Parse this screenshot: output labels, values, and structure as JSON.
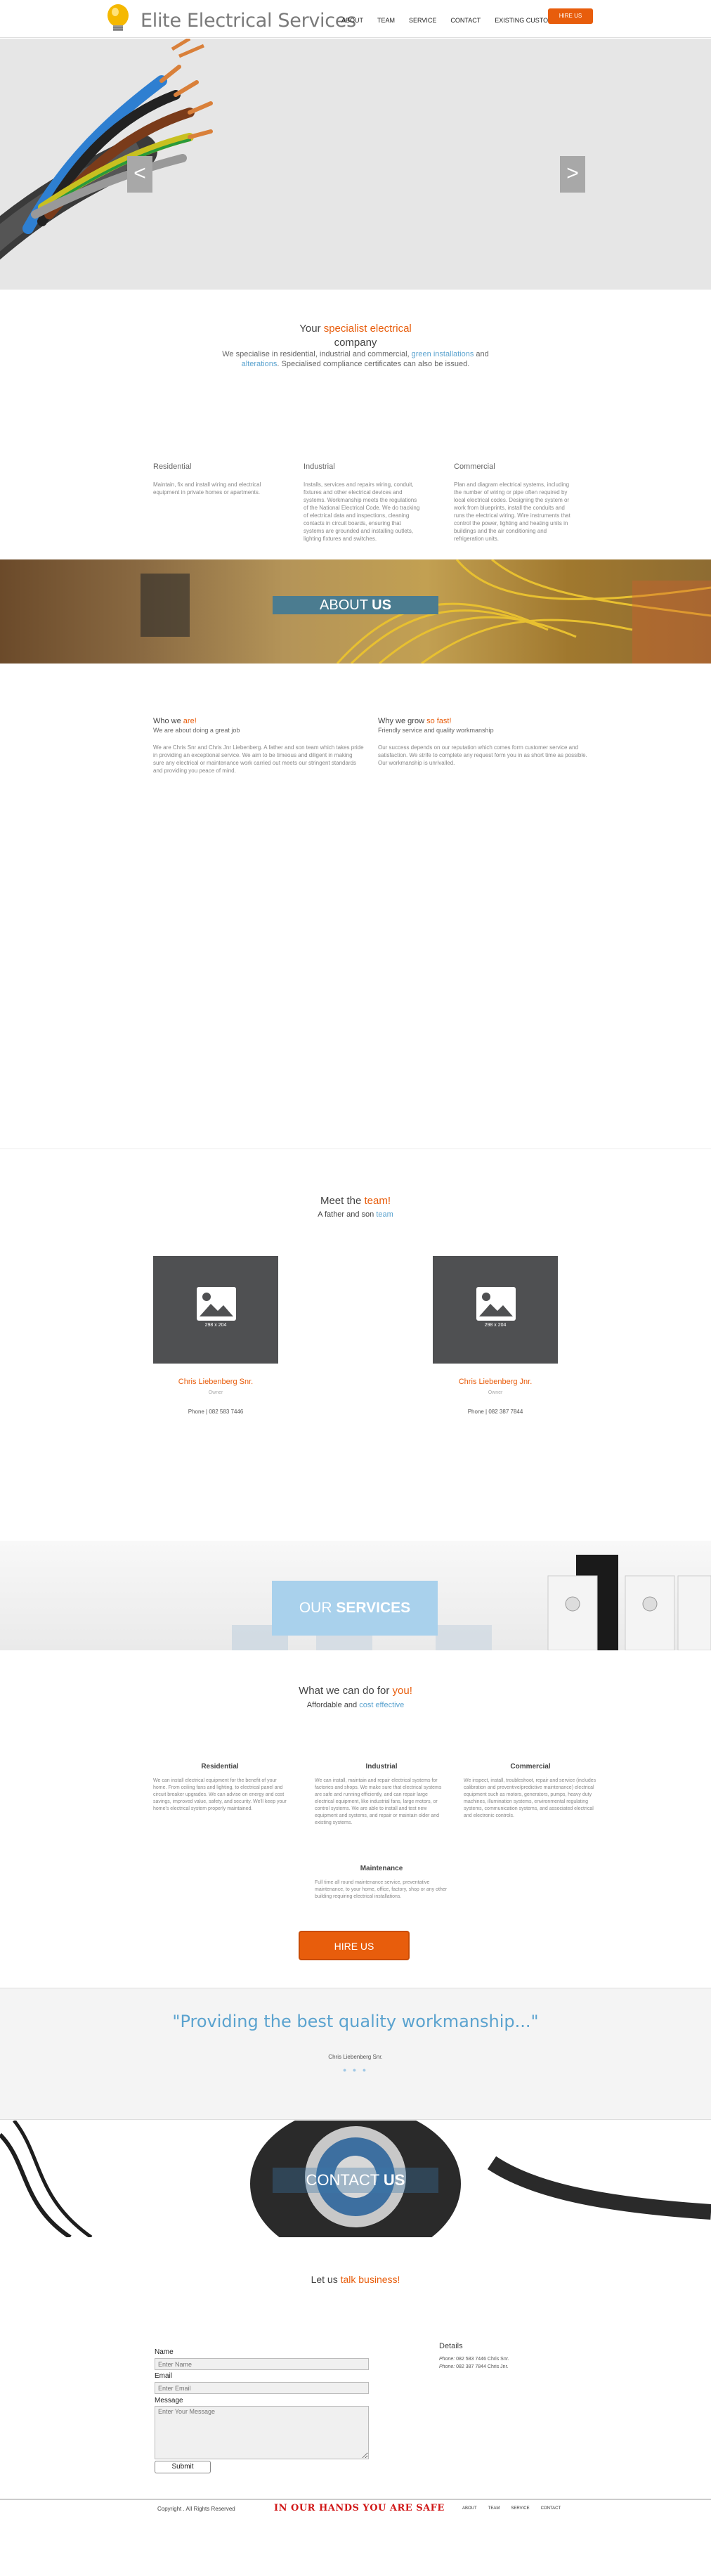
{
  "header": {
    "logo_text": "Elite Electrical Services",
    "nav": [
      "ABOUT",
      "TEAM",
      "SERVICE",
      "CONTACT",
      "EXISTING CUSTOMER"
    ],
    "hire_button": "HIRE US"
  },
  "hero": {
    "prev": "<",
    "next": ">"
  },
  "specialist": {
    "title_pre": "Your ",
    "title_highlight": "specialist electrical",
    "title_post": "company",
    "desc_1": "We specialise in residential, industrial and commercial, ",
    "desc_link_1": "green installations",
    "desc_2": " and ",
    "desc_link_2": "alterations",
    "desc_3": ". Specialised compliance certificates can also be issued."
  },
  "sectors": [
    {
      "title": "Residential",
      "text": "Maintain, fix and install wiring and electrical equipment in private homes or apartments."
    },
    {
      "title": "Industrial",
      "text": "Installs, services and repairs wiring, conduit, fixtures and other electrical devices and systems. Workmanship meets the regulations of the National Electrical Code. We do tracking of electrical data and inspections, cleaning contacts in circuit boards, ensuring that systems are grounded and installing outlets, lighting fixtures and switches."
    },
    {
      "title": "Commercial",
      "text": "Plan and diagram electrical systems, including the number of wiring or pipe often required by local electrical codes. Designing the system or work from blueprints, install the conduits and runs the electrical wiring. Wire instruments that control the power, lighting and heating units in buildings and the air conditioning and refrigeration units."
    }
  ],
  "about": {
    "banner_light": "ABOUT ",
    "banner_bold": "US",
    "who": {
      "title_pre": "Who we ",
      "title_highlight": "are!",
      "sub": "We are about doing a great job",
      "text": "We are Chris Snr and Chris Jnr Liebenberg. A father and son team which takes pride in providing an exceptional service. We aim to be timeous and diligent in making sure any electrical or maintenance work carried out meets our stringent standards and providing you peace of mind."
    },
    "why": {
      "title_pre": "Why we grow ",
      "title_highlight": "so fast!",
      "sub": "Friendly service and quality workmanship",
      "text": "Our success depends on our reputation which comes form customer service and satisfaction. We strife to complete any request form you in as short time as possible. Our workmanship is unrivalled."
    }
  },
  "team": {
    "title_pre": "Meet the ",
    "title_highlight": "team!",
    "sub_pre": "A father and son ",
    "sub_highlight": "team",
    "placeholder_size": "298 x 204",
    "members": [
      {
        "name": "Chris Liebenberg Snr.",
        "role": "Owner",
        "phone": "Phone | 082 583 7446"
      },
      {
        "name": "Chris Liebenberg Jnr.",
        "role": "Owner",
        "phone": "Phone | 082 387 7844"
      }
    ]
  },
  "services": {
    "banner_light": "OUR ",
    "banner_bold": "SERVICES",
    "title_pre": "What we can do for ",
    "title_highlight": "you!",
    "sub_pre": "Affordable and ",
    "sub_highlight": "cost effective",
    "items": [
      {
        "title": "Residential",
        "text": "We can install electrical equipment for the benefit of your home. From ceiling fans and lighting, to electrical panel and circuit breaker upgrades. We can advise on energy and cost savings, improved value, safety, and security. We'll keep your home's electrical system properly maintained."
      },
      {
        "title": "Industrial",
        "text": "We can install, maintain and repair electrical systems for factories and shops. We make sure that electrical systems are safe and running efficiently, and can repair large electrical equipment, like industrial fans, large motors, or control systems. We are able to install and test new equipment and systems, and repair or maintain older and existing systems."
      },
      {
        "title": "Commercial",
        "text": "We inspect, install, troubleshoot, repair and service (includes calibration and preventive/predictive maintenance) electrical equipment such as motors, generators, pumps, heavy duty machines, illumination systems, environmental regulating systems, communication systems, and associated electrical and electronic controls."
      },
      {
        "title": "Maintenance",
        "text": "Full time all round maintenance service, preventative maintenance, to your home, office, factory, shop or any other building requiring electrical installations."
      }
    ],
    "hire_button": "HIRE US"
  },
  "quote": {
    "text": "\"Providing the best quality workmanship...\"",
    "author": "Chris Liebenberg Snr.",
    "dots": "● ● ●"
  },
  "contact": {
    "banner_light": "CONTACT ",
    "banner_bold": "US",
    "title_pre": "Let us ",
    "title_highlight": "talk business!",
    "form": {
      "name_label": "Name",
      "name_placeholder": "Enter Name",
      "email_label": "Email",
      "email_placeholder": "Enter Email",
      "message_label": "Message",
      "message_placeholder": "Enter Your Message",
      "submit": "Submit"
    },
    "details": {
      "title": "Details",
      "phone_1_label": "Phone: ",
      "phone_1": "082 583 7446 Chris Snr.",
      "phone_2_label": "Phone: ",
      "phone_2": "082 387 7844 Chris Jnr."
    }
  },
  "footer": {
    "copyright": "Copyright . All Rights Reserved",
    "slogan": "IN OUR HANDS YOU ARE SAFE",
    "nav": [
      "ABOUT",
      "TEAM",
      "SERVICE",
      "CONTACT"
    ]
  },
  "colors": {
    "accent_orange": "#e85d0c",
    "accent_blue": "#5ba3cf",
    "dark_placeholder": "#4f5052"
  }
}
